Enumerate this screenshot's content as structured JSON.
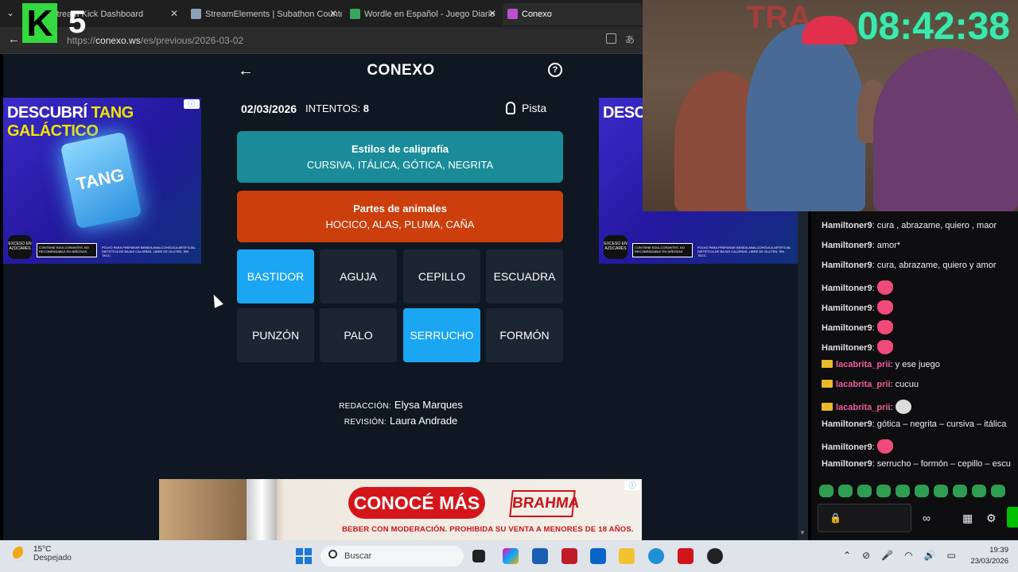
{
  "browser": {
    "tabs": [
      {
        "label": "Stream Kick Dashboard",
        "fav": "#53fc18"
      },
      {
        "label": "StreamElements | Subathon Countdown",
        "fav": "#8aa0b8"
      },
      {
        "label": "Wordle en Español - Juego Diario",
        "fav": "#3ba55c"
      },
      {
        "label": "Conexo",
        "fav": "#b94fd1"
      }
    ],
    "url_prefix": "https://",
    "url_host": "conexo.ws",
    "url_path": "/es/previous/2026-03-02"
  },
  "logo": {
    "letter": "K",
    "number": "5"
  },
  "game": {
    "title": "CONEXO",
    "date": "02/03/2026",
    "tries_label": "INTENTOS:",
    "tries_value": "8",
    "hint_label": "Pista",
    "groups": [
      {
        "title": "Estilos de caligrafía",
        "words": "CURSIVA, ITÁLICA, GÓTICA, NEGRITA",
        "color": "#1a8c99"
      },
      {
        "title": "Partes de animales",
        "words": "HOCICO, ALAS, PLUMA, CAÑA",
        "color": "#cc3f0c"
      }
    ],
    "tiles": [
      {
        "label": "BASTIDOR",
        "selected": true
      },
      {
        "label": "AGUJA",
        "selected": false
      },
      {
        "label": "CEPILLO",
        "selected": false
      },
      {
        "label": "ESCUADRA",
        "selected": false
      },
      {
        "label": "PUNZÓN",
        "selected": false
      },
      {
        "label": "PALO",
        "selected": false
      },
      {
        "label": "SERRUCHO",
        "selected": true
      },
      {
        "label": "FORMÓN",
        "selected": false
      }
    ],
    "credits": {
      "redaccion_label": "REDACCIÓN:",
      "redaccion_name": "Elysa Marques",
      "revision_label": "REVISIÓN:",
      "revision_name": "Laura Andrade"
    }
  },
  "ads": {
    "side_headline_a": "DESCUBRÍ",
    "side_headline_b": "TANG GALÁCTICO",
    "side_headline_short": "DESC",
    "pack_text": "TANG",
    "octagon": "EXCESO EN AZÚCARES",
    "warning": "CONTIENE EDULCORANTES, NO RECOMENDABLE EN NIÑOS/AS",
    "fine": "POLVO PARA PREPARAR BEBIDA ANALCOHÓLICA ARTIFICIAL DIETÉTICA DE BAJAS CALORÍAS. LIBRE DE GLUTEN. SIN TACC.",
    "bottom_cta": "CONOCÉ MÁS",
    "bottom_brand": "BRAHMA",
    "bottom_legal": "BEBER CON MODERACIÓN. PROHIBIDA SU VENTA A MENORES DE 18 AÑOS."
  },
  "stream": {
    "timer": "08:42:38"
  },
  "chat": {
    "messages": [
      {
        "user": "Hamiltoner9",
        "color": "#e0e0e0",
        "text": "cura , abrazame, quiero , maor",
        "crown": false,
        "emote": false
      },
      {
        "user": "Hamiltoner9",
        "color": "#e0e0e0",
        "text": "amor*",
        "crown": false,
        "emote": false
      },
      {
        "user": "Hamiltoner9",
        "color": "#e0e0e0",
        "text": "cura, abrazame, quiero y amor",
        "crown": false,
        "emote": false
      },
      {
        "user": "Hamiltoner9",
        "color": "#e0e0e0",
        "text": "",
        "crown": false,
        "emote": true
      },
      {
        "user": "Hamiltoner9",
        "color": "#e0e0e0",
        "text": "",
        "crown": false,
        "emote": true
      },
      {
        "user": "Hamiltoner9",
        "color": "#e0e0e0",
        "text": "",
        "crown": false,
        "emote": true
      },
      {
        "user": "Hamiltoner9",
        "color": "#e0e0e0",
        "text": "",
        "crown": false,
        "emote": true
      },
      {
        "user": "lacabrita_prii",
        "color": "#f25c9c",
        "text": "y ese juego",
        "crown": true,
        "emote": false
      },
      {
        "user": "lacabrita_prii",
        "color": "#f25c9c",
        "text": "cucuu",
        "crown": true,
        "emote": false
      },
      {
        "user": "lacabrita_prii",
        "color": "#f25c9c",
        "text": "",
        "crown": true,
        "emote": true
      },
      {
        "user": "Hamiltoner9",
        "color": "#e0e0e0",
        "text": "gótica – negrita – cursiva – itálica",
        "crown": false,
        "emote": false
      },
      {
        "user": "Hamiltoner9",
        "color": "#e0e0e0",
        "text": "",
        "crown": false,
        "emote": true
      },
      {
        "user": "Hamiltoner9",
        "color": "#e0e0e0",
        "text": "serrucho – formón – cepillo – escu",
        "crown": false,
        "emote": false
      }
    ],
    "input_icon": "lock-icon"
  },
  "taskbar": {
    "temp": "15°C",
    "weather": "Despejado",
    "search_placeholder": "Buscar",
    "time": "19:39",
    "date": "23/03/2026"
  }
}
